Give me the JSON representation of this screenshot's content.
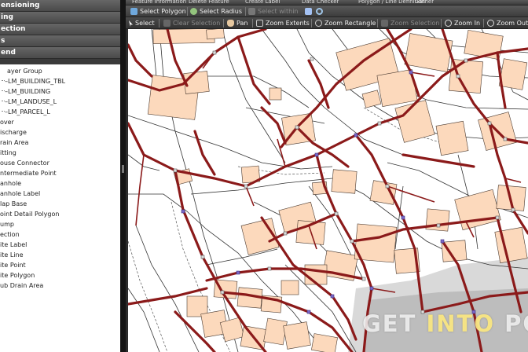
{
  "left_panel": {
    "sections": [
      "ensioning",
      "ing",
      "ection",
      "s",
      "end"
    ],
    "layers": [
      {
        "label": "ayer Group",
        "indent": 9,
        "checkbox": false
      },
      {
        "label": "–LM_BUILDING_TBL",
        "indent": 0,
        "checkbox": true
      },
      {
        "label": "–LM_BUILDING",
        "indent": 0,
        "checkbox": true
      },
      {
        "label": "–LM_LANDUSE_L",
        "indent": 0,
        "checkbox": true
      },
      {
        "label": "–LM_PARCEL_L",
        "indent": 0,
        "checkbox": true
      },
      {
        "label": "over",
        "indent": 0,
        "checkbox": false
      },
      {
        "label": "ischarge",
        "indent": 0,
        "checkbox": false
      },
      {
        "label": "rain Area",
        "indent": 0,
        "checkbox": false
      },
      {
        "label": "itting",
        "indent": 0,
        "checkbox": false
      },
      {
        "label": "ouse Connector",
        "indent": 0,
        "checkbox": false
      },
      {
        "label": "ntermediate Point",
        "indent": 0,
        "checkbox": false
      },
      {
        "label": "anhole",
        "indent": 0,
        "checkbox": false
      },
      {
        "label": "anhole Label",
        "indent": 0,
        "checkbox": false
      },
      {
        "label": "lap Base",
        "indent": 0,
        "checkbox": false
      },
      {
        "label": "oint Detail Polygon",
        "indent": 0,
        "checkbox": false
      },
      {
        "label": "ump",
        "indent": 0,
        "checkbox": false
      },
      {
        "label": "ection",
        "indent": 0,
        "checkbox": false
      },
      {
        "label": "ite Label",
        "indent": 0,
        "checkbox": false
      },
      {
        "label": "ite Line",
        "indent": 0,
        "checkbox": false
      },
      {
        "label": "ite Point",
        "indent": 0,
        "checkbox": false
      },
      {
        "label": "ite Polygon",
        "indent": 0,
        "checkbox": false
      },
      {
        "label": "ub Drain Area",
        "indent": 0,
        "checkbox": false
      }
    ]
  },
  "toolbar_top": {
    "items": [
      "Feature Information",
      "Delete Feature",
      "Create Label",
      "Data Checker",
      "Polygon / Line Definition",
      "Gather"
    ]
  },
  "toolbar_select": {
    "select_polygon": "Select Polygon",
    "select_radius": "Select Radius",
    "select_within": "Select within"
  },
  "toolbar_nav": {
    "select": "Select",
    "clear_selection": "Clear Selection",
    "pan": "Pan",
    "zoom_extents": "Zoom Extents",
    "zoom_rectangle": "Zoom Rectangle",
    "zoom_selection": "Zoom Selection",
    "zoom_in": "Zoom In",
    "zoom_out": "Zoom Out"
  },
  "map": {
    "watermark_part1": "GET ",
    "watermark_part2": "INTO",
    "watermark_part3": " PC",
    "colors": {
      "pipe": "#8b1a1a",
      "building": "#fcd9bc",
      "line": "#333333",
      "node": "#7b68c8"
    }
  }
}
